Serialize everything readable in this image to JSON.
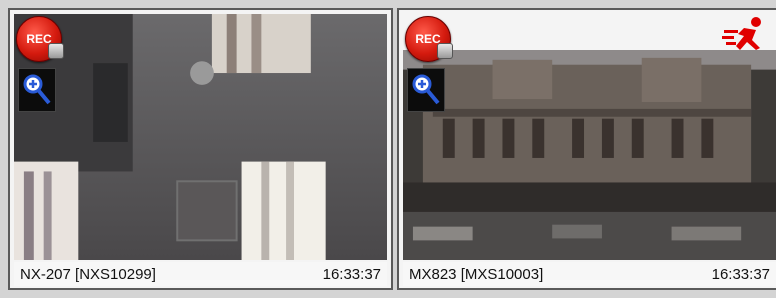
{
  "cameras": [
    {
      "name": "NX-207 [NXS10299]",
      "time": "16:33:37",
      "rec_label": "REC"
    },
    {
      "name": "MX823 [MXS10003]",
      "time": "16:33:37",
      "rec_label": "REC"
    }
  ],
  "icons": {
    "record": "record-icon",
    "zoom": "magnifier-plus-icon",
    "motion": "running-person-icon"
  },
  "colors": {
    "record_red": "#d41a0e",
    "motion_red": "#e00000",
    "zoom_blue": "#2a5bd7"
  }
}
